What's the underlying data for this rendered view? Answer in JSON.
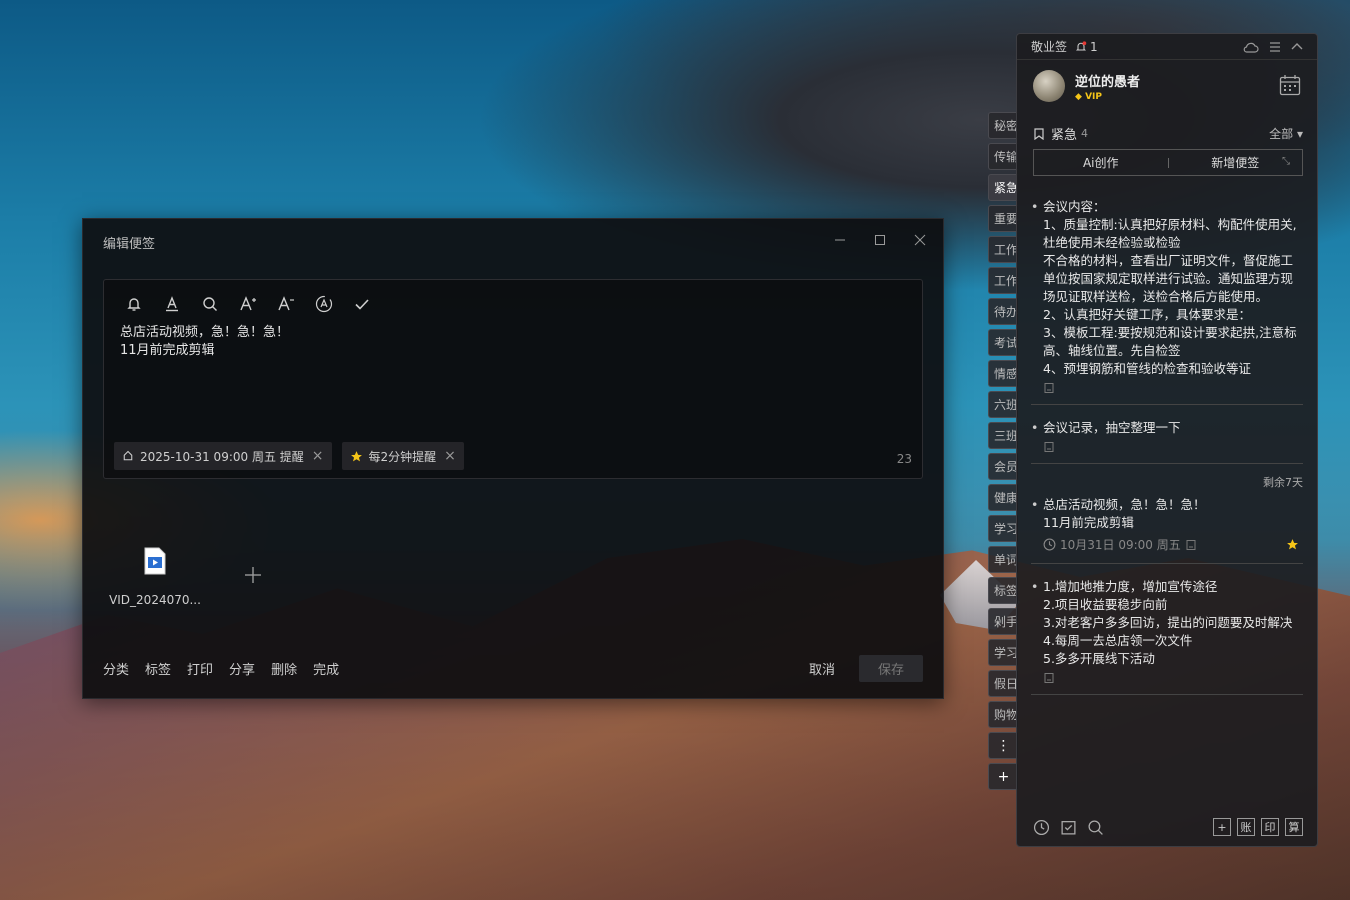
{
  "dialog": {
    "title": "编辑便签",
    "note_line1": "总店活动视频，急！急！急！",
    "note_line2": "11月前完成剪辑",
    "tag_reminder": "2025-10-31 09:00 周五 提醒",
    "tag_repeat": "每2分钟提醒",
    "char_count": "23",
    "attachment_name": "VID_2024070...",
    "actions": [
      "分类",
      "标签",
      "打印",
      "分享",
      "删除",
      "完成"
    ],
    "cancel": "取消",
    "save": "保存"
  },
  "side_tabs": [
    "秘密",
    "传输",
    "紧急",
    "重要",
    "工作",
    "工作",
    "待办",
    "考试",
    "情感",
    "六班",
    "三班",
    "会员",
    "健康",
    "学习",
    "单词",
    "标签",
    "剁手",
    "学习",
    "假日",
    "购物"
  ],
  "panel": {
    "app_name": "敬业签",
    "notif_count": "1",
    "username": "逆位的愚者",
    "vip": "VIP",
    "category": "紧急",
    "category_count": "4",
    "filter": "全部",
    "ai_btn": "Ai创作",
    "new_btn": "新增便签",
    "note1": "会议内容：\n1、质量控制:认真把好原材料、构配件使用关,杜绝使用未经检验或检验\n不合格的材料，查看出厂证明文件，督促施工单位按国家规定取样进行试验。通知监理方现场见证取样送检，送检合格后方能使用。\n2、认真把好关键工序，具体要求是：\n3、模板工程:要按规范和设计要求起拱,注意标高、轴线位置。先自检签\n4、预埋钢筋和管线的检查和验收等证",
    "note2": "会议记录，抽空整理一下",
    "note3_remain": "剩余7天",
    "note3_line1": "总店活动视频，急！急！急！",
    "note3_line2": "11月前完成剪辑",
    "note3_time": "10月31日 09:00 周五",
    "note4": "1.增加地推力度，增加宣传途径\n2.项目收益要稳步向前\n3.对老客户多多回访，提出的问题要及时解决\n4.每周一去总店领一次文件\n5.多多开展线下活动",
    "bottom_right": [
      "+",
      "账",
      "印",
      "算"
    ]
  }
}
